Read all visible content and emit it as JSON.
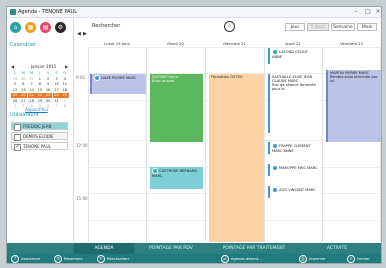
{
  "window": {
    "title": "Agenda - TENONE PAUL"
  },
  "toolbar": {
    "search_label": "Rechercher",
    "views": [
      "Jour",
      "5 jours",
      "Semaine",
      "Mois"
    ]
  },
  "sidebar": {
    "calendar_title": "Calendrier",
    "month_label": "Janvier 2015",
    "weekdays": [
      "L",
      "M",
      "M",
      "J",
      "V",
      "S",
      "D"
    ],
    "weeks": [
      [
        "29",
        "30",
        "31",
        "1",
        "2",
        "3",
        "4"
      ],
      [
        "5",
        "6",
        "7",
        "8",
        "9",
        "10",
        "11"
      ],
      [
        "12",
        "13",
        "14",
        "15",
        "16",
        "17",
        "18"
      ],
      [
        "19",
        "20",
        "21",
        "22",
        "23",
        "24",
        "25"
      ],
      [
        "26",
        "27",
        "28",
        "29",
        "30",
        "31",
        "1"
      ],
      [
        "2",
        "3",
        "4",
        "5",
        "6",
        "7",
        "8"
      ]
    ],
    "today_label": "Aujourd'hui",
    "users_title": "Utilisateurs",
    "users": [
      {
        "name": "FREDDIC JEAN",
        "color": "#8ed4d4",
        "checked": false
      },
      {
        "name": "DEMOS ELODIE",
        "color": "#f5f5f5",
        "checked": false
      },
      {
        "name": "TENONE PAUL",
        "color": "#ffffff",
        "checked": true
      }
    ]
  },
  "agenda": {
    "days": [
      "Lundi 19 Janv",
      "Mardi 20",
      "Mercredi 21",
      "Jeudi 22",
      "Vendredi 23"
    ],
    "hours": [
      "9:00",
      "12:00",
      "15:00"
    ],
    "events": {
      "mon1": "DAZE PIERRE MARC",
      "tue1a": "DUPONT Henri",
      "tue1b": "Bilan annuel",
      "tue2": "CASTROSE BERNARD MARC",
      "wed1": "Formation OSTEO",
      "thu0": "LAFOND CECILE ANNE",
      "thu1a": "SAITHALLE ELISE JEAN CLAUDE MARC",
      "thu1b": "Rdv de séance terminée pour la",
      "thu2": "FRAPPE CLEMENT MARC ANNE",
      "thu3": "MAROPPE ERIC MARC",
      "thu4": "ZOO VINCENT MARC",
      "fri1a": "MARTIN PIERRE MARC",
      "fri1b": "Rendez-vous terminée par lui"
    }
  },
  "bottom_tabs": [
    "AGENDA",
    "POINTAGE PAR RDV",
    "POINTAGE PAR TRAITEMENT",
    "ACTIVITÉ"
  ],
  "footer": {
    "buttons": [
      "Assistance",
      "Répertoire",
      "Réactualiser",
      "Agenda distant...",
      "Imprimer",
      "Fermer"
    ]
  }
}
